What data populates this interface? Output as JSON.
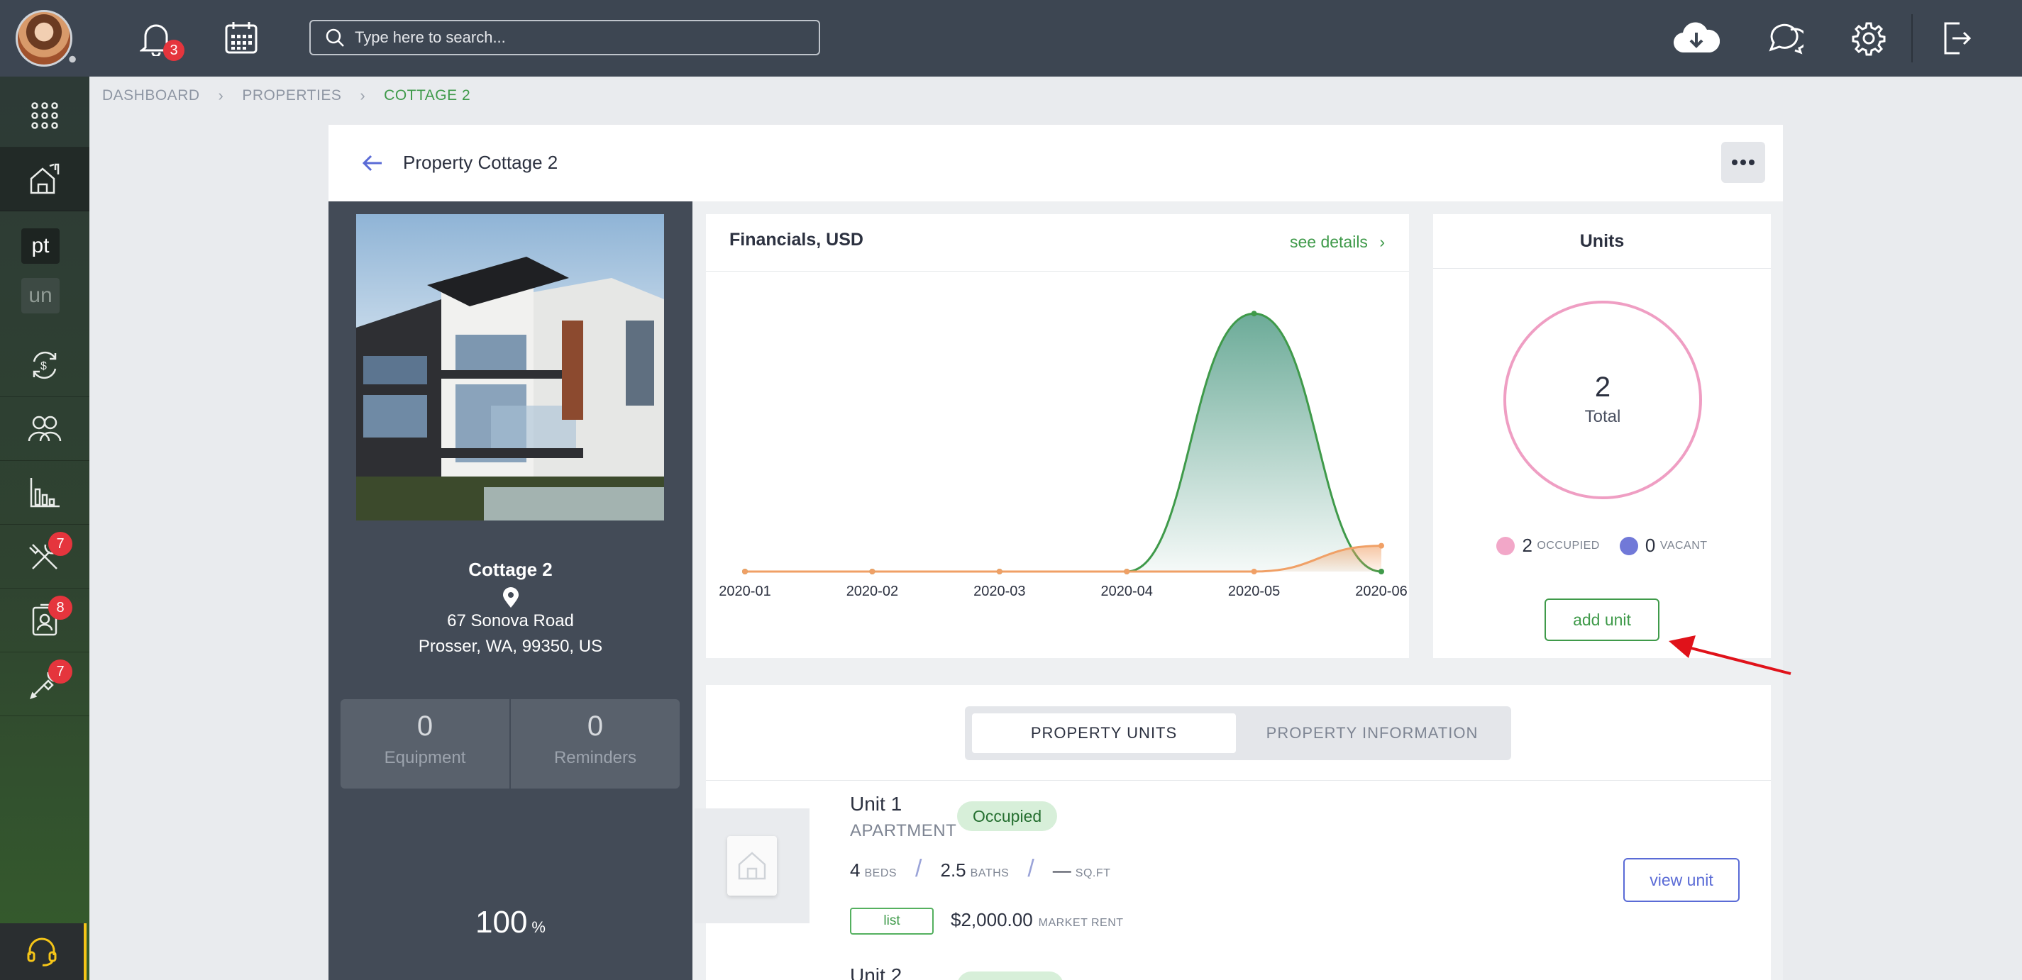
{
  "topbar": {
    "notifications_count": "3",
    "search_placeholder": "Type here to search..."
  },
  "sidebar": {
    "chips": [
      "pt",
      "un"
    ],
    "badges": {
      "maintenance": "7",
      "tenants": "8",
      "tools": "7"
    }
  },
  "breadcrumb": {
    "items": [
      "DASHBOARD",
      "PROPERTIES"
    ],
    "current": "COTTAGE 2"
  },
  "header": {
    "title": "Property Cottage 2"
  },
  "property": {
    "name": "Cottage 2",
    "address_line1": "67 Sonova Road",
    "address_line2": "Prosser, WA, 99350, US",
    "equipment_value": "0",
    "equipment_label": "Equipment",
    "reminders_value": "0",
    "reminders_label": "Reminders",
    "percent_value": "100",
    "percent_sign": "%"
  },
  "financials": {
    "title": "Financials, USD",
    "link_label": "see details",
    "colors": {
      "series_green": "#3f9a4a",
      "series_orange": "#f0a066"
    }
  },
  "chart_data": {
    "type": "area",
    "x": [
      "2020-01",
      "2020-02",
      "2020-03",
      "2020-04",
      "2020-05",
      "2020-06"
    ],
    "series": [
      {
        "values": [
          0,
          0,
          0,
          0,
          100,
          0
        ]
      },
      {
        "values": [
          0,
          0,
          0,
          0,
          0,
          10
        ]
      }
    ],
    "ylim": [
      0,
      105
    ],
    "grid": false
  },
  "units": {
    "title": "Units",
    "total": "2",
    "total_label": "Total",
    "occupied_count": "2",
    "occupied_label": "OCCUPIED",
    "vacant_count": "0",
    "vacant_label": "VACANT",
    "add_label": "add unit",
    "colors": {
      "occupied": "#f2a7c8",
      "vacant": "#7179d8"
    }
  },
  "tabs": {
    "active": "PROPERTY UNITS",
    "inactive": "PROPERTY INFORMATION"
  },
  "unit_list": [
    {
      "name": "Unit 1",
      "type": "APARTMENT",
      "status": "Occupied",
      "beds": "4",
      "beds_label": "BEDS",
      "baths": "2.5",
      "baths_label": "BATHS",
      "sqft": "—",
      "sqft_label": "SQ.FT",
      "tag": "list",
      "rent": "$2,000.00",
      "rent_label": "MARKET RENT",
      "view_label": "view unit"
    },
    {
      "name": "Unit 2"
    }
  ]
}
